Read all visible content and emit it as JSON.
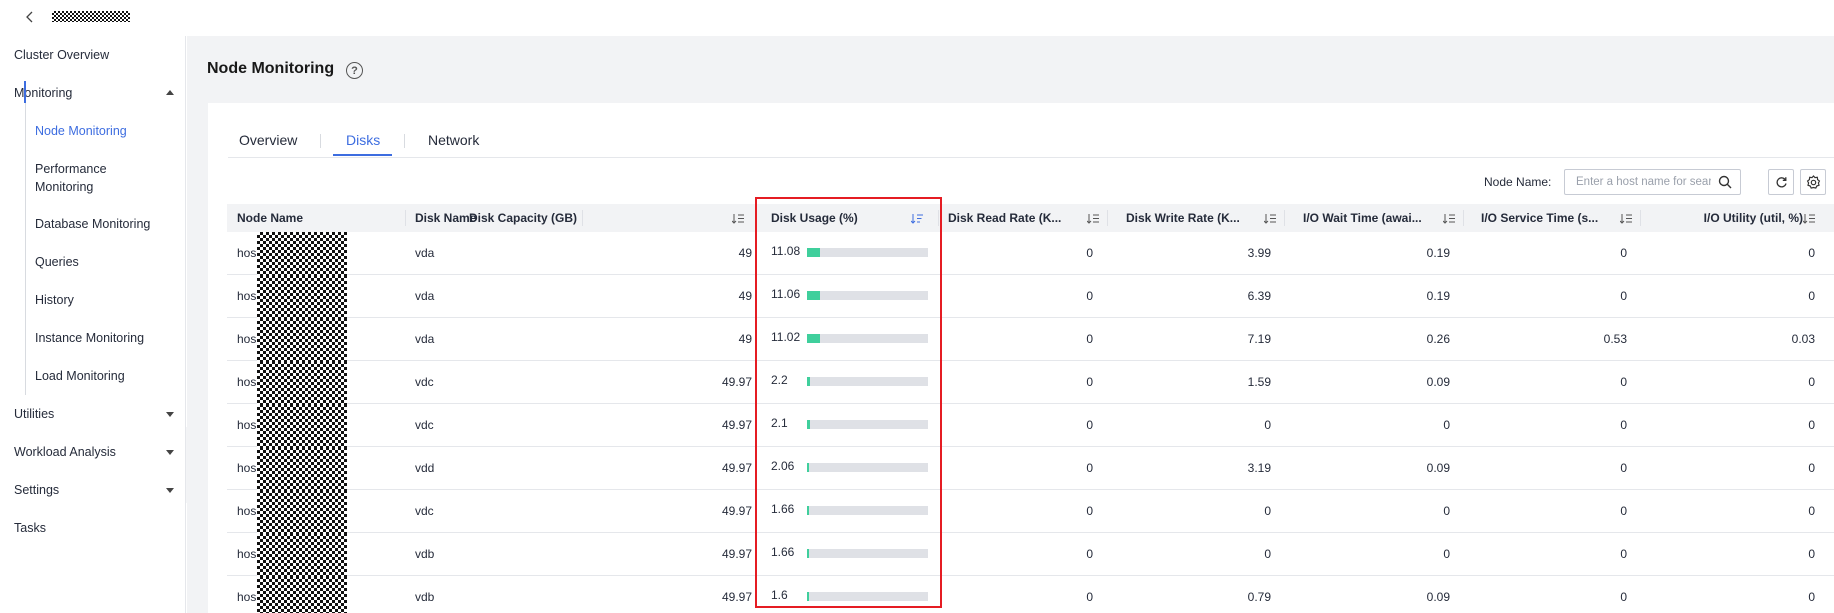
{
  "colors": {
    "accent": "#3d6de0",
    "highlight": "#e51c23",
    "bar_fill": "#3fcf9c",
    "bar_track": "#dfe1e6"
  },
  "sidebar": {
    "items": [
      {
        "label": "Cluster Overview"
      },
      {
        "label": "Monitoring",
        "expanded": true
      },
      {
        "label": "Utilities",
        "expanded": false
      },
      {
        "label": "Workload Analysis",
        "expanded": false
      },
      {
        "label": "Settings",
        "expanded": false
      },
      {
        "label": "Tasks"
      }
    ],
    "monitoring_sub": [
      {
        "label": "Node Monitoring",
        "active": true
      },
      {
        "label": "Performance",
        "label2": "Monitoring"
      },
      {
        "label": "Database Monitoring"
      },
      {
        "label": "Queries"
      },
      {
        "label": "History"
      },
      {
        "label": "Instance Monitoring"
      },
      {
        "label": "Load Monitoring"
      }
    ]
  },
  "page": {
    "title": "Node Monitoring",
    "help_icon": "?"
  },
  "tabs": [
    {
      "label": "Overview",
      "active": false
    },
    {
      "label": "Disks",
      "active": true
    },
    {
      "label": "Network",
      "active": false
    }
  ],
  "filter": {
    "label": "Node Name:",
    "placeholder": "Enter a host name for search"
  },
  "table": {
    "columns": [
      "Node Name",
      "Disk Name",
      "Disk Capacity (GB)",
      "Disk Usage (%)",
      "Disk Read Rate (K...",
      "Disk Write Rate (K...",
      "I/O Wait Time (awai...",
      "I/O Service Time (s...",
      "I/O Utility (util, %)"
    ],
    "rows": [
      {
        "node": "hos",
        "disk": "vda",
        "capacity": "49",
        "usage": "11.08",
        "read": "0",
        "write": "3.99",
        "wait": "0.19",
        "service": "0",
        "util": "0"
      },
      {
        "node": "hos",
        "disk": "vda",
        "capacity": "49",
        "usage": "11.06",
        "read": "0",
        "write": "6.39",
        "wait": "0.19",
        "service": "0",
        "util": "0"
      },
      {
        "node": "hos",
        "disk": "vda",
        "capacity": "49",
        "usage": "11.02",
        "read": "0",
        "write": "7.19",
        "wait": "0.26",
        "service": "0.53",
        "util": "0.03"
      },
      {
        "node": "hos",
        "disk": "vdc",
        "capacity": "49.97",
        "usage": "2.2",
        "read": "0",
        "write": "1.59",
        "wait": "0.09",
        "service": "0",
        "util": "0"
      },
      {
        "node": "hos",
        "disk": "vdc",
        "capacity": "49.97",
        "usage": "2.1",
        "read": "0",
        "write": "0",
        "wait": "0",
        "service": "0",
        "util": "0"
      },
      {
        "node": "hos",
        "disk": "vdd",
        "capacity": "49.97",
        "usage": "2.06",
        "read": "0",
        "write": "3.19",
        "wait": "0.09",
        "service": "0",
        "util": "0"
      },
      {
        "node": "hos",
        "disk": "vdc",
        "capacity": "49.97",
        "usage": "1.66",
        "read": "0",
        "write": "0",
        "wait": "0",
        "service": "0",
        "util": "0"
      },
      {
        "node": "hos",
        "disk": "vdb",
        "capacity": "49.97",
        "usage": "1.66",
        "read": "0",
        "write": "0",
        "wait": "0",
        "service": "0",
        "util": "0"
      },
      {
        "node": "hos",
        "disk": "vdb",
        "capacity": "49.97",
        "usage": "1.6",
        "read": "0",
        "write": "0.79",
        "wait": "0.09",
        "service": "0",
        "util": "0"
      }
    ]
  }
}
